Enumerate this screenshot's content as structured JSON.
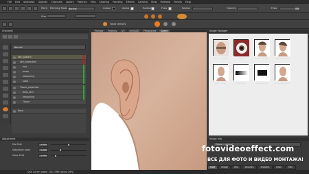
{
  "menu": [
    "File",
    "Edit",
    "Selection",
    "Objects",
    "Channels",
    "Layers",
    "Patches",
    "Files",
    "Shading",
    "Painting",
    "Effects",
    "Camera",
    "View",
    "Portfolio",
    "Panels",
    "Help"
  ],
  "toolbar": {
    "paint_label": "Paint",
    "mode_label": "Painting Mode",
    "mode_value": "Normal",
    "color_label": "Colour",
    "alpha_label": "Alpha",
    "radius_label": "Radius",
    "flow_label": "Flow",
    "opacity_label": "Opacity",
    "size_label": "Size",
    "tonal_label": "Tonal density"
  },
  "left_panel": {
    "title": "Channels",
    "blend_value": "Normal",
    "layers": [
      "skin_pattern",
      "skin_projection",
      "hair",
      "bump",
      "retouching",
      "scale",
      "Tissue_projection",
      "base_skin",
      "retouching",
      "Tissue",
      "Bone"
    ],
    "adjustment_title": "Adjustment",
    "sliders": [
      {
        "label": "Mix Shift",
        "value": "0.000",
        "fraction": 0.5
      },
      {
        "label": "Saturation Scale",
        "value": "0.000",
        "fraction": 0.25
      },
      {
        "label": "Value Shift",
        "value": "0.000",
        "fraction": 0.1
      }
    ]
  },
  "viewport": {
    "tabs": [
      "Preview",
      "Projects",
      "UV",
      "Ortho2D",
      "Perspective",
      "Scene"
    ],
    "active_tab": "Scene"
  },
  "image_manager": {
    "title": "Image Manager",
    "thumbnails": [
      {
        "label": "Color - natural"
      },
      {
        "label": "eye"
      },
      {
        "label": "Front - front"
      },
      {
        "label": "Left - left side"
      },
      {
        "label": "Left - side"
      },
      {
        "label": "Gradient"
      },
      {
        "label": "shadow_arc"
      },
      {
        "label": "Ramp/Quadrle"
      }
    ],
    "info_title": "Image Info",
    "info_value": "Colour - natural"
  },
  "bottom_tabs": [
    "Shelf",
    "Image",
    "Hist",
    "Brushes",
    "Shaders",
    "Chan",
    "Pain"
  ],
  "status": "Disk Cache usage: 128.23MB (about 26%)",
  "watermark": {
    "site": "fotovideoeffect.com",
    "slogan": "ВСЕ ДЛЯ ФОТО И ВИДЕО МОНТАЖА!"
  }
}
